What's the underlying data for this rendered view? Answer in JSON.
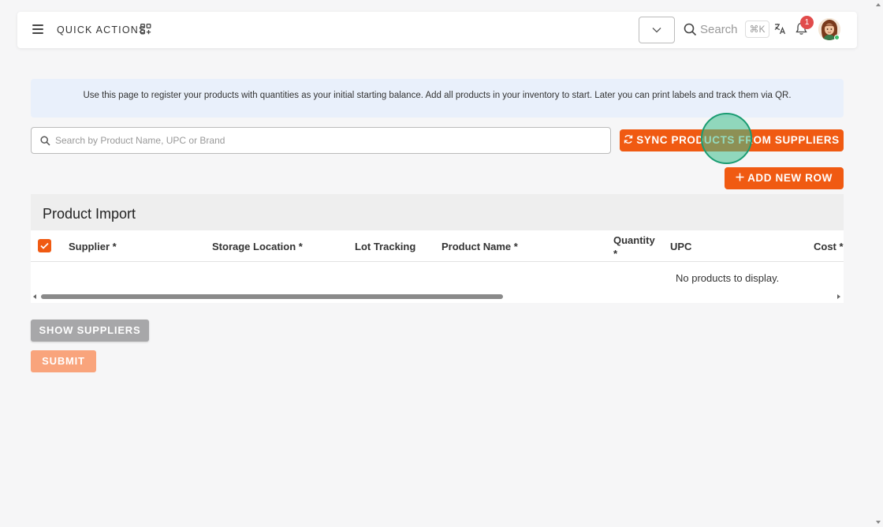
{
  "topbar": {
    "quick_actions_label": "QUICK ACTIONS",
    "search_placeholder": "Search",
    "shortcut": "⌘K",
    "notification_count": "1"
  },
  "info_banner": {
    "text": "Use this page to register your products with quantities as your initial starting balance. Add all products in your inventory to start. Later you can print labels and track them via QR."
  },
  "product_search": {
    "placeholder": "Search by Product Name, UPC or Brand",
    "value": ""
  },
  "buttons": {
    "sync": "SYNC PRODUCTS FROM SUPPLIERS",
    "add_row": "ADD NEW ROW",
    "show_suppliers": "SHOW SUPPLIERS",
    "submit": "SUBMIT"
  },
  "table": {
    "title": "Product Import",
    "columns": {
      "supplier": "Supplier *",
      "storage_location": "Storage Location *",
      "lot_tracking": "Lot Tracking",
      "product_name": "Product Name *",
      "quantity_line1": "Quantity",
      "quantity_line2": "*",
      "upc": "UPC",
      "cost": "Cost *"
    },
    "empty_message": "No products to display.",
    "select_all_checked": true
  },
  "colors": {
    "accent": "#f05a12",
    "banner_bg": "#e9f0fb",
    "submit_disabled": "#f9a47c",
    "grey_button": "#a7a7a9",
    "badge": "#e14b4b"
  },
  "icons": [
    "menu-icon",
    "quick-actions-icon",
    "chevron-down-icon",
    "search-icon",
    "translate-icon",
    "bell-icon",
    "avatar",
    "sync-icon",
    "plus-icon",
    "check-icon"
  ]
}
